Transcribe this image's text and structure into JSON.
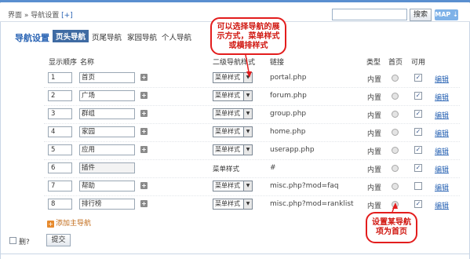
{
  "breadcrumb": {
    "path": "界面 » 导航设置",
    "add": "[+]"
  },
  "search": {
    "value": "",
    "button": "搜索"
  },
  "map_button": "MAP ⇣",
  "page_title": "导航设置",
  "tabs": [
    {
      "label": "页头导航",
      "active": true
    },
    {
      "label": "页尾导航",
      "active": false
    },
    {
      "label": "家园导航",
      "active": false
    },
    {
      "label": "个人导航",
      "active": false
    }
  ],
  "columns": {
    "order": "显示顺序",
    "name": "名称",
    "style": "二级导航样式",
    "link": "链接",
    "type": "类型",
    "home": "首页",
    "enabled": "可用"
  },
  "rows": [
    {
      "order": "1",
      "name": "首页",
      "style": "菜单样式",
      "select": true,
      "link": "portal.php",
      "type": "内置",
      "home": false,
      "enabled": true,
      "edit": "编辑"
    },
    {
      "order": "2",
      "name": "广场",
      "style": "菜单样式",
      "select": true,
      "link": "forum.php",
      "type": "内置",
      "home": false,
      "enabled": true,
      "edit": "编辑"
    },
    {
      "order": "3",
      "name": "群组",
      "style": "菜单样式",
      "select": true,
      "link": "group.php",
      "type": "内置",
      "home": false,
      "enabled": true,
      "edit": "编辑"
    },
    {
      "order": "4",
      "name": "家园",
      "style": "菜单样式",
      "select": true,
      "link": "home.php",
      "type": "内置",
      "home": false,
      "enabled": true,
      "edit": "编辑"
    },
    {
      "order": "5",
      "name": "应用",
      "style": "菜单样式",
      "select": true,
      "link": "userapp.php",
      "type": "内置",
      "home": false,
      "enabled": true,
      "edit": "编辑"
    },
    {
      "order": "6",
      "name": "插件",
      "style": "菜单样式",
      "select": false,
      "link": "#",
      "type": "内置",
      "home": false,
      "enabled": true,
      "edit": "编辑"
    },
    {
      "order": "7",
      "name": "帮助",
      "style": "菜单样式",
      "select": true,
      "link": "misc.php?mod=faq",
      "type": "内置",
      "home": false,
      "enabled": false,
      "edit": "编辑"
    },
    {
      "order": "8",
      "name": "排行榜",
      "style": "菜单样式",
      "select": true,
      "link": "misc.php?mod=ranklist",
      "type": "内置",
      "home": false,
      "enabled": true,
      "edit": "编辑"
    }
  ],
  "add_main_nav": "添加主导航",
  "delete_label": "删?",
  "submit_button": "提交",
  "annotations": {
    "callout_style": "可以选择导航的展示方式，菜单样式或横排样式",
    "callout_home": "设置某导航项为首页"
  },
  "colors": {
    "accent": "#2a64b4",
    "tab_active": "#3f6ba3",
    "annotation": "#e31d1d"
  }
}
